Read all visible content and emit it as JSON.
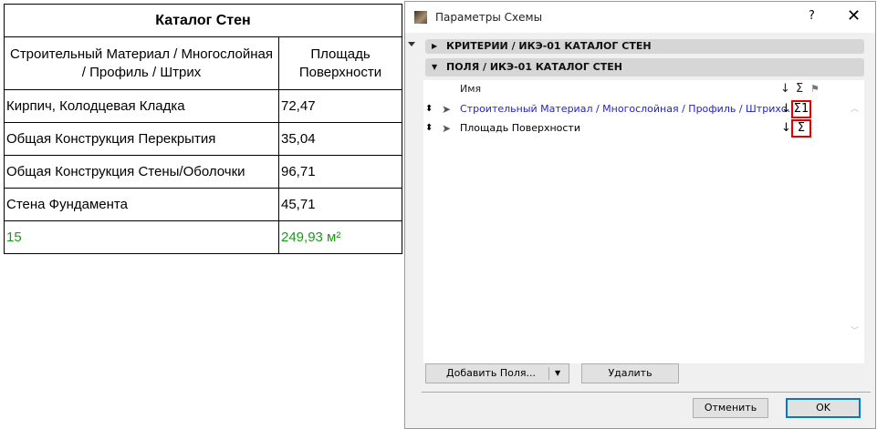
{
  "catalog": {
    "title": "Каталог Стен",
    "headers": [
      "Строительный Материал / Многослойная / Профиль / Штрих",
      "Площадь Поверхности"
    ],
    "rows": [
      [
        "Кирпич, Колодцевая Кладка",
        "72,47"
      ],
      [
        "Общая Конструкция Перекрытия",
        "35,04"
      ],
      [
        "Общая Конструкция Стены/Оболочки",
        "96,71"
      ],
      [
        "Стена Фундамента",
        "45,71"
      ]
    ],
    "total": [
      "15",
      "249,93 м²"
    ]
  },
  "dialog": {
    "title": "Параметры Схемы",
    "help": "?",
    "close": "✕",
    "sections": [
      "КРИТЕРИИ / ИКЭ-01 КАТАЛОГ СТЕН",
      "ПОЛЯ / ИКЭ-01 КАТАЛОГ СТЕН"
    ],
    "list_header": {
      "name": "Имя",
      "sort": "↓",
      "sum": "Σ",
      "flag": "⚑"
    },
    "fields": [
      {
        "name": "Строительный Материал / Многослойная / Профиль / Штрихо...",
        "sort": "↓",
        "sum": "Σ1"
      },
      {
        "name": "Площадь Поверхности",
        "sort": "↓",
        "sum": "Σ"
      }
    ],
    "add_button": "Добавить Поля...",
    "delete_button": "Удалить",
    "cancel_button": "Отменить",
    "ok_button": "OK"
  },
  "colors": {
    "link": "#2222cc",
    "total": "#1a9a1a",
    "highlight": "#e00000"
  }
}
